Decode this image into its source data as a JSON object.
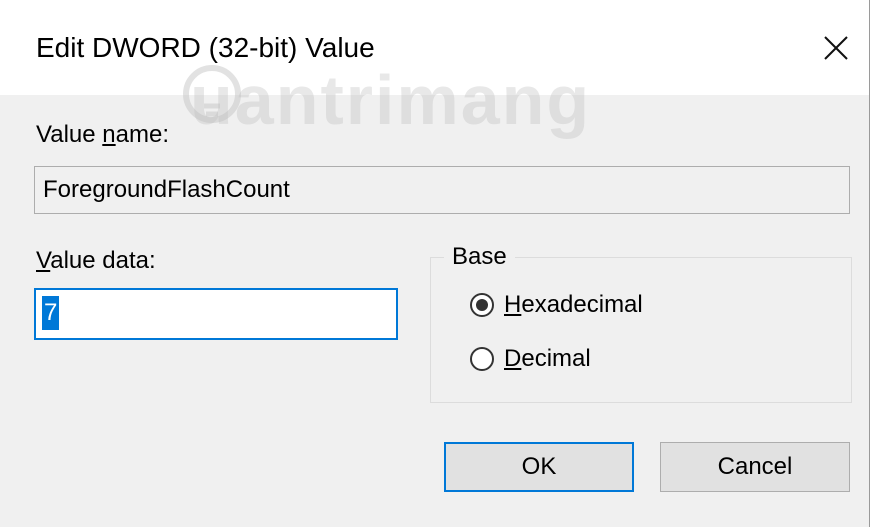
{
  "dialog": {
    "title": "Edit DWORD (32-bit) Value",
    "close_icon": "close-icon"
  },
  "watermark": {
    "text": "uantrimang"
  },
  "value_name": {
    "label_pre": "Value ",
    "label_accel": "n",
    "label_post": "ame:",
    "value": "ForegroundFlashCount"
  },
  "value_data": {
    "label_accel": "V",
    "label_post": "alue data:",
    "value": "7"
  },
  "base": {
    "legend": "Base",
    "options": [
      {
        "accel": "H",
        "rest": "exadecimal",
        "selected": true
      },
      {
        "accel": "D",
        "rest": "ecimal",
        "selected": false
      }
    ]
  },
  "buttons": {
    "ok": "OK",
    "cancel": "Cancel"
  },
  "colors": {
    "accent": "#0078d7",
    "dialog_bg": "#f0f0f0",
    "button_bg": "#e1e1e1"
  }
}
